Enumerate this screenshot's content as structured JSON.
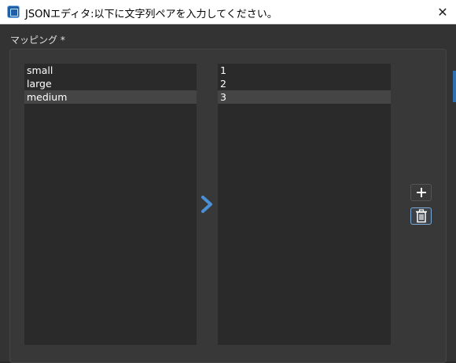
{
  "window": {
    "title": "JSONエディタ:以下に文字列ペアを入力してください。",
    "icon": "app-icon",
    "close_glyph": "✕"
  },
  "section": {
    "label": "マッピング *"
  },
  "keys": [
    "small",
    "large",
    "medium"
  ],
  "values": [
    "1",
    "2",
    "3"
  ],
  "selected_index": 2,
  "buttons": {
    "add_icon": "plus-icon",
    "delete_icon": "trash-icon"
  },
  "colors": {
    "accent": "#4a90d9",
    "selection": "#454545",
    "list_bg": "#2a2a2a"
  }
}
